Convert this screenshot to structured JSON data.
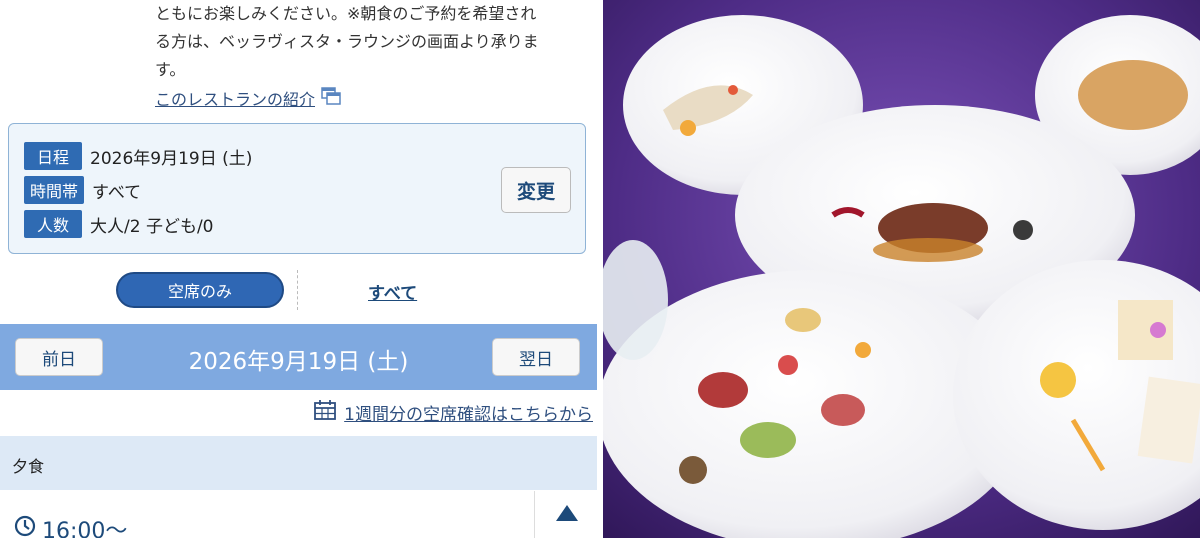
{
  "intro": {
    "lines": [
      "ともにお楽しみください。※朝食のご予約を希望され",
      "る方は、ベッラヴィスタ・ラウンジの画面より承りま",
      "す。"
    ],
    "link": "このレストランの紹介",
    "link_icon": "window-icon"
  },
  "info": {
    "date_tag": "日程",
    "date_value": "2026年9月19日 (土)",
    "time_tag": "時間帯",
    "time_value": "すべて",
    "people_tag": "人数",
    "people_value": "大人/2 子ども/0",
    "change_label": "変更"
  },
  "filter": {
    "available_only": "空席のみ",
    "all": "すべて"
  },
  "date_nav": {
    "prev": "前日",
    "title": "2026年9月19日 (土)",
    "next": "翌日"
  },
  "week_link": {
    "icon": "calendar-icon",
    "label": "1週間分の空席確認はこちらから"
  },
  "meal": {
    "label": "夕食"
  },
  "slot": {
    "icon": "clock-icon",
    "time": "16:00〜",
    "toggle_icon": "triangle-up-icon"
  },
  "colors": {
    "accent": "#2f6bb3",
    "date_bar": "#7fa9e0",
    "meal_bar": "#dde9f6",
    "photo_bg": "#4a2a78"
  }
}
